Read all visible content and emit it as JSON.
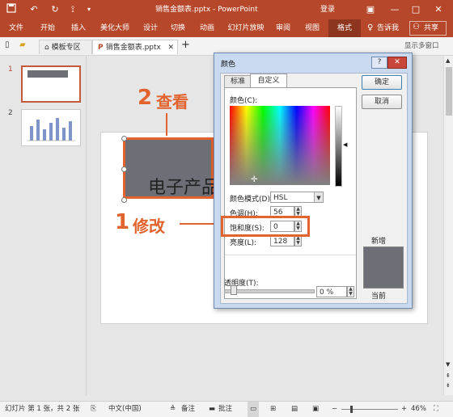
{
  "window": {
    "title": "销售金额表.pptx - PowerPoint",
    "login": "登录"
  },
  "ribbon": {
    "tabs": [
      "文件",
      "开始",
      "插入",
      "美化大师",
      "设计",
      "切换",
      "动画",
      "幻灯片放映",
      "审阅",
      "视图",
      "格式"
    ],
    "active_tab": "格式",
    "tell_me": "告诉我",
    "share": "共享"
  },
  "tabstrip": {
    "template_tab": "模板专区",
    "doc_tab": "销售金额表.pptx",
    "show_multi_window": "显示多窗口"
  },
  "thumbnails": [
    {
      "number": "1"
    },
    {
      "number": "2"
    }
  ],
  "slide": {
    "text": "电子产品"
  },
  "annotations": {
    "step2_num": "2",
    "step2_text": "查看",
    "step1_num": "1",
    "step1_text": "修改"
  },
  "dialog": {
    "title": "颜色",
    "tabs": [
      "标准",
      "自定义"
    ],
    "active_tab": "自定义",
    "ok": "确定",
    "cancel": "取消",
    "colors_label": "颜色(C):",
    "color_model_label": "颜色模式(D):",
    "color_model_value": "HSL",
    "hue_label": "色调(H):",
    "hue_value": "56",
    "saturation_label": "饱和度(S):",
    "saturation_value": "0",
    "luminance_label": "亮度(L):",
    "luminance_value": "128",
    "transparency_label": "透明度(T):",
    "transparency_value": "0 %",
    "new_label": "新增",
    "current_label": "当前",
    "preview_color": "#6e6f76"
  },
  "statusbar": {
    "slide_info": "幻灯片 第 1 张，共 2 张",
    "language": "中文(中国)",
    "notes": "备注",
    "comments": "批注",
    "zoom": "46%"
  },
  "colors": {
    "accent": "#b7472a",
    "annotation": "#e2632e",
    "selected_shape": "#6e6f76"
  }
}
